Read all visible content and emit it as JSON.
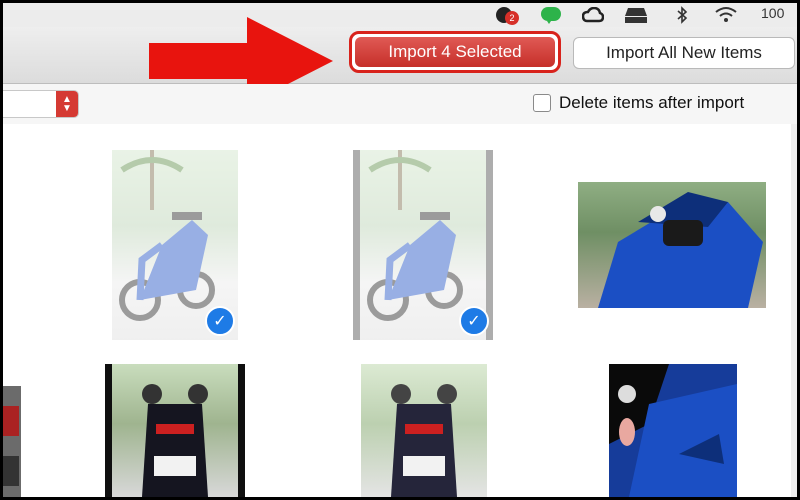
{
  "menubar": {
    "notification_badge": "2",
    "battery_text": "100",
    "icons": [
      "notification-icon",
      "line-app-icon",
      "creative-cloud-icon",
      "drive-icon",
      "bluetooth-icon",
      "wifi-icon"
    ]
  },
  "toolbar": {
    "import_selected_label": "Import 4 Selected",
    "import_all_label": "Import All New Items"
  },
  "options": {
    "delete_after_import_label": "Delete items after import",
    "delete_after_import_checked": false
  },
  "photos": [
    {
      "row": 1,
      "col": 1,
      "selected": true
    },
    {
      "row": 1,
      "col": 2,
      "selected": true
    },
    {
      "row": 1,
      "col": 3,
      "selected": false
    },
    {
      "row": 2,
      "col": 0,
      "selected": false
    },
    {
      "row": 2,
      "col": 1,
      "selected": false
    },
    {
      "row": 2,
      "col": 2,
      "selected": false
    },
    {
      "row": 2,
      "col": 3,
      "selected": false
    }
  ],
  "colors": {
    "accent_red": "#d8231c",
    "selection_blue": "#1e7be6",
    "bike_blue": "#1b4fc4"
  }
}
